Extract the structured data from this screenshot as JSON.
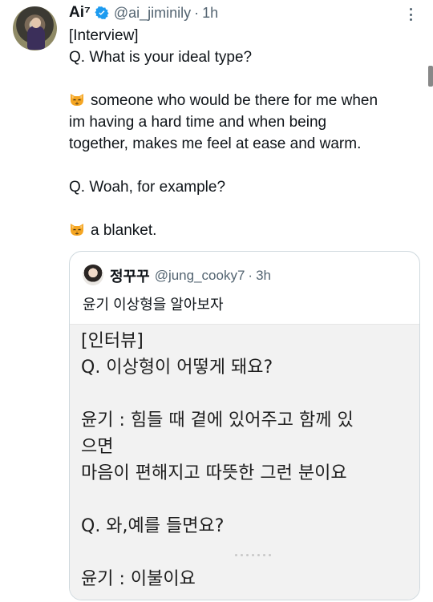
{
  "tweet": {
    "author_name": "Ai⁷",
    "handle": "@ai_jiminily",
    "time": "1h",
    "separator": "·",
    "lines": [
      {
        "text": "[Interview]"
      },
      {
        "text": "Q. What is your ideal type?"
      },
      {
        "blank": true
      },
      {
        "icon": "cat-face-emoji",
        "text": "someone who would be there for me when"
      },
      {
        "text": "im having a hard time and when being"
      },
      {
        "text": "together, makes me feel at ease and warm."
      },
      {
        "blank": true
      },
      {
        "text": "Q. Woah, for example?"
      },
      {
        "blank": true
      },
      {
        "icon": "cat-face-emoji",
        "text": "a blanket."
      }
    ]
  },
  "quoted": {
    "author_name": "정꾸꾸",
    "handle": "@jung_cooky7",
    "separator": "·",
    "time": "3h",
    "text": "윤기 이상형을 알아보자",
    "image_lines": [
      {
        "text": "[인터뷰]"
      },
      {
        "text": "Q. 이상형이 어떻게 돼요?"
      },
      {
        "blank": true
      },
      {
        "text": "윤기 : 힘들 때 곁에 있어주고 함께 있"
      },
      {
        "text": "으면"
      },
      {
        "text": "마음이 편해지고 따뜻한 그런 분이요"
      },
      {
        "blank": true
      },
      {
        "text": "Q. 와,예를 들면요?"
      },
      {
        "blank": true
      },
      {
        "text": "윤기 : 이불이요"
      }
    ]
  },
  "colors": {
    "verified": "#1d9bf0",
    "secondary_text": "#536471",
    "primary_text": "#0f1419",
    "border": "#cfd9de"
  }
}
